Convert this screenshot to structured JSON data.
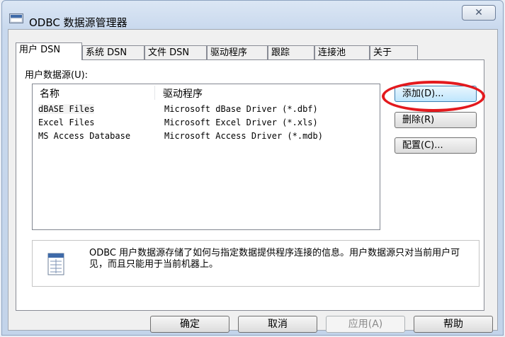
{
  "window": {
    "title": "ODBC 数据源管理器",
    "close_label": "✕"
  },
  "tabs": [
    {
      "label": "用户 DSN"
    },
    {
      "label": "系统 DSN"
    },
    {
      "label": "文件 DSN"
    },
    {
      "label": "驱动程序"
    },
    {
      "label": "跟踪"
    },
    {
      "label": "连接池"
    },
    {
      "label": "关于"
    }
  ],
  "user_dsn": {
    "group_label": "用户数据源(U):",
    "columns": {
      "name": "名称",
      "driver": "驱动程序"
    },
    "rows": [
      {
        "name": "dBASE Files",
        "driver": "Microsoft dBase Driver (*.dbf)"
      },
      {
        "name": "Excel Files",
        "driver": "Microsoft Excel Driver (*.xls)"
      },
      {
        "name": "MS Access Database",
        "driver": "Microsoft Access Driver (*.mdb)"
      }
    ],
    "buttons": {
      "add": "添加(D)...",
      "remove": "删除(R)",
      "configure": "配置(C)..."
    },
    "info_text": "ODBC 用户数据源存储了如何与指定数据提供程序连接的信息。用户数据源只对当前用户可见，而且只能用于当前机器上。"
  },
  "footer": {
    "ok": "确定",
    "cancel": "取消",
    "apply": "应用(A)",
    "help": "帮助"
  },
  "colors": {
    "highlight_ellipse": "#e3191d",
    "title_bar": "#c9d9ee"
  }
}
